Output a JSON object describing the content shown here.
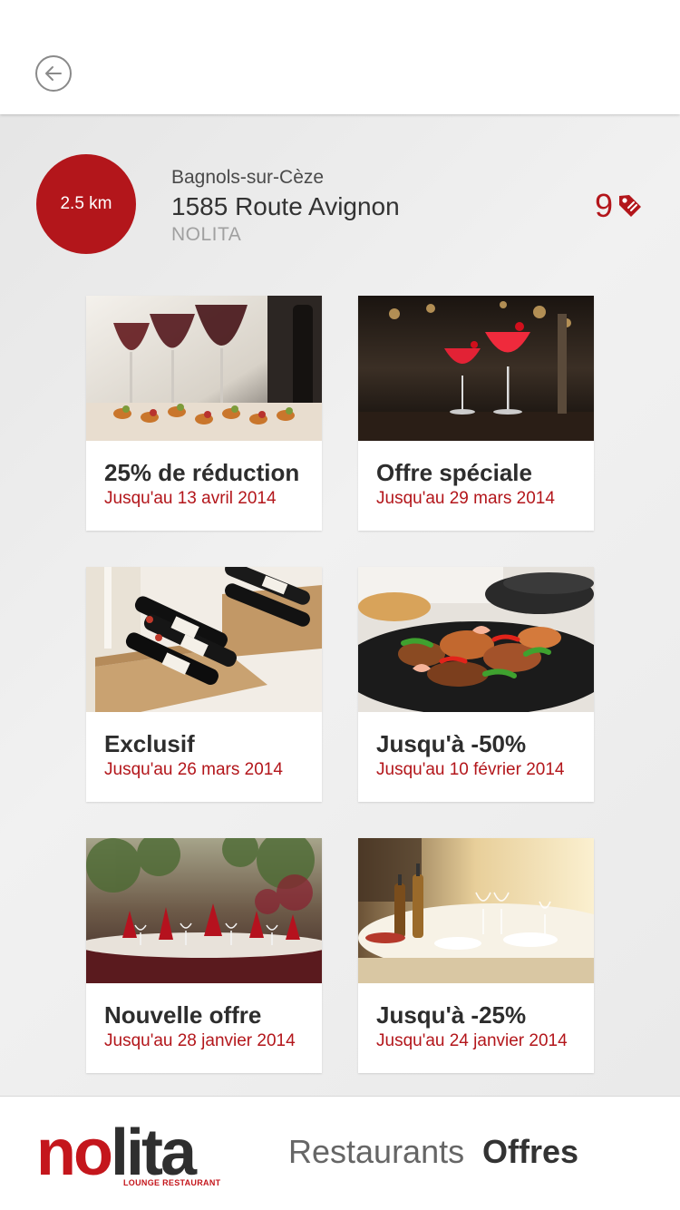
{
  "header": {
    "distance": "2.5 km",
    "city": "Bagnols-sur-Cèze",
    "address": "1585 Route Avignon",
    "venue": "NOLITA",
    "offer_count": "9"
  },
  "offers": [
    {
      "title": "25% de réduction",
      "date": "Jusqu'au 13 avril 2014",
      "image": "wine-glasses-appetizers"
    },
    {
      "title": "Offre spéciale",
      "date": "Jusqu'au 29 mars 2014",
      "image": "red-cocktails-bar"
    },
    {
      "title": "Exclusif",
      "date": "Jusqu'au 26 mars 2014",
      "image": "wine-crates"
    },
    {
      "title": "Jusqu'à -50%",
      "date": "Jusqu'au 10 février 2014",
      "image": "shrimp-fajita-skillet"
    },
    {
      "title": "Nouvelle offre",
      "date": "Jusqu'au 28 janvier 2014",
      "image": "dining-room-red-napkins"
    },
    {
      "title": "Jusqu'à -25%",
      "date": "Jusqu'au 24 janvier 2014",
      "image": "set-table-terrace"
    }
  ],
  "footer": {
    "logo_text_no": "no",
    "logo_text_lita": "lita",
    "logo_tagline": "LOUNGE RESTAURANT",
    "nav_restaurants": "Restaurants",
    "nav_offres": "Offres"
  },
  "colors": {
    "accent": "#b3161b",
    "title_text": "#2d2d2d",
    "muted_text": "#a0a0a0"
  },
  "icons": {
    "back": "arrow-left-circle-icon",
    "offers": "price-tag-icon"
  }
}
